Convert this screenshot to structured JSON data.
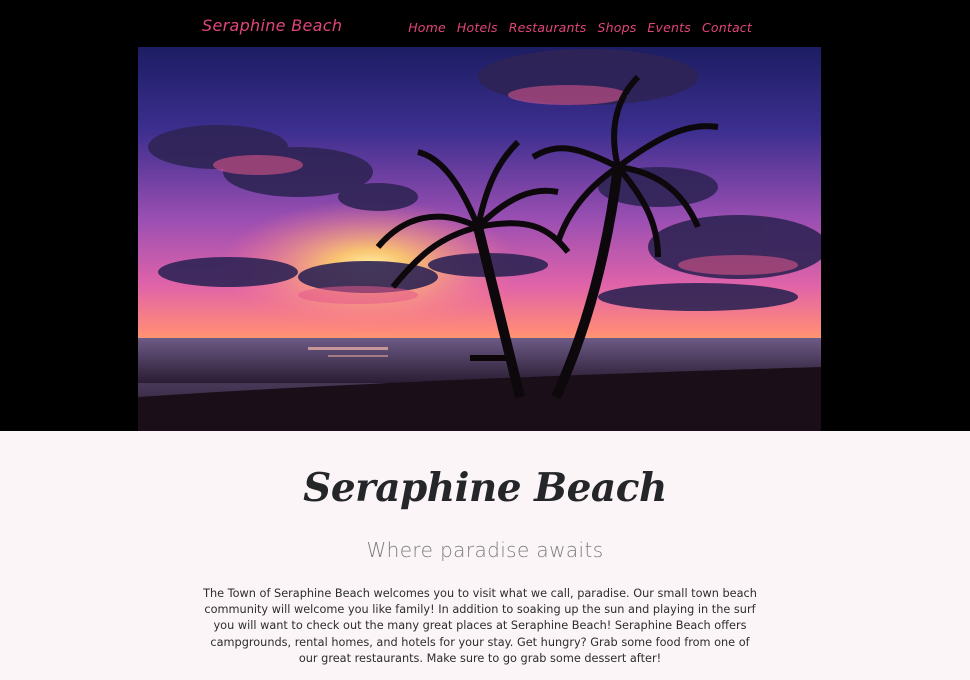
{
  "header": {
    "brand": "Seraphine Beach",
    "nav": [
      {
        "label": "Home"
      },
      {
        "label": "Hotels"
      },
      {
        "label": "Restaurants"
      },
      {
        "label": "Shops"
      },
      {
        "label": "Events"
      },
      {
        "label": "Contact"
      }
    ]
  },
  "hero": {
    "image": "sunset-beach-palm-trees"
  },
  "intro": {
    "title": "Seraphine Beach",
    "tagline": "Where paradise awaits",
    "body": "The Town of Seraphine Beach welcomes you to visit what we call, paradise. Our small town beach community will welcome you like family! In addition to soaking up the sun and playing in the surf you will want to check out the many great places at Seraphine Beach! Seraphine Beach offers campgrounds, rental homes, and hotels for your stay. Get hungry? Grab some food from one of our great restaurants. Make sure to go grab some dessert after!"
  },
  "colors": {
    "accent": "#e0457b",
    "header_bg": "#000000",
    "page_bg": "#fbf5f7",
    "title_text": "#25262a",
    "tagline_text": "#7d7d80"
  }
}
